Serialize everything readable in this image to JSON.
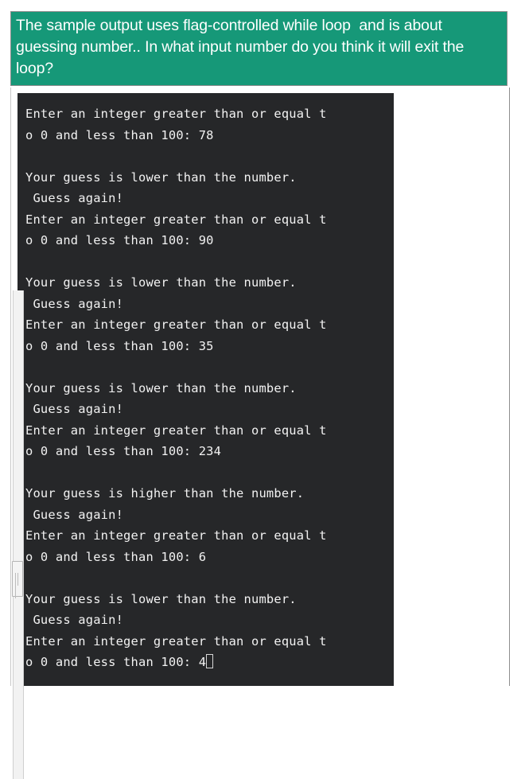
{
  "colors": {
    "banner_background": "#169878",
    "banner_text": "#ffffff",
    "console_background": "#262729",
    "console_text": "#f2f2f2",
    "page_background": "#ffffff",
    "border": "#8d8d8d"
  },
  "question": {
    "text": "The sample output uses flag-controlled while loop  and is about guessing number.. In what input number do you think it will exit the loop?"
  },
  "console": {
    "prompt": "Enter an integer greater than or equal to 0 and less than 100: ",
    "lower_message": "Your guess is lower than the number.",
    "higher_message": "Your guess is higher than the number.",
    "guess_again": " Guess again!",
    "guesses": [
      "78",
      "90",
      "35",
      "234",
      "6",
      "4"
    ],
    "cursor": "block-cursor",
    "lines": [
      "Enter an integer greater than or equal t",
      "o 0 and less than 100: 78",
      "",
      "Your guess is lower than the number.",
      " Guess again!",
      "Enter an integer greater than or equal t",
      "o 0 and less than 100: 90",
      "",
      "Your guess is lower than the number.",
      " Guess again!",
      "Enter an integer greater than or equal t",
      "o 0 and less than 100: 35",
      "",
      "Your guess is lower than the number.",
      " Guess again!",
      "Enter an integer greater than or equal t",
      "o 0 and less than 100: 234",
      "",
      "Your guess is higher than the number.",
      " Guess again!",
      "Enter an integer greater than or equal t",
      "o 0 and less than 100: 6",
      "",
      "Your guess is lower than the number.",
      " Guess again!",
      "Enter an integer greater than or equal t",
      "o 0 and less than 100: 4"
    ]
  },
  "scrollbar": {
    "orientation": "vertical",
    "position": "left"
  }
}
